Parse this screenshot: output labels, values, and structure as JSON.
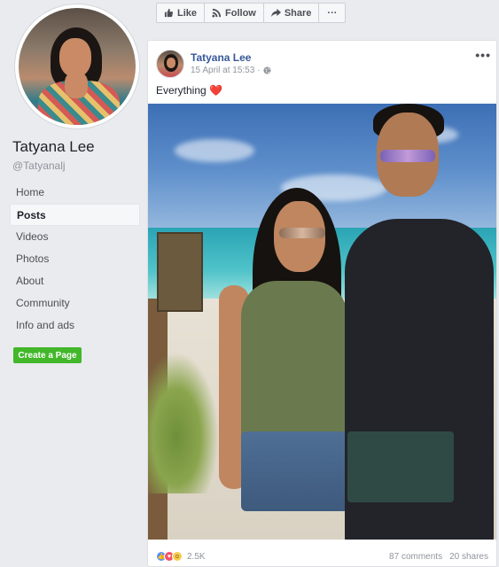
{
  "profile": {
    "name": "Tatyana Lee",
    "handle": "@Tatyanalj"
  },
  "nav": [
    {
      "label": "Home",
      "active": false
    },
    {
      "label": "Posts",
      "active": true
    },
    {
      "label": "Videos",
      "active": false
    },
    {
      "label": "Photos",
      "active": false
    },
    {
      "label": "About",
      "active": false
    },
    {
      "label": "Community",
      "active": false
    },
    {
      "label": "Info and ads",
      "active": false
    }
  ],
  "create_page_label": "Create a Page",
  "actions": {
    "like": "Like",
    "follow": "Follow",
    "share": "Share",
    "more": "···"
  },
  "post": {
    "author": "Tatyana Lee",
    "date": "15 April at 15:53",
    "separator": "·",
    "text": "Everything",
    "emoji": "❤️",
    "more": "•••",
    "reactions_count": "2.5K",
    "comments": "87 comments",
    "shares": "20 shares"
  },
  "colors": {
    "link": "#365899",
    "create_button": "#42b72a",
    "like_reaction": "#5890ff",
    "love_reaction": "#f25268",
    "wow_reaction": "#f7cd4f"
  }
}
